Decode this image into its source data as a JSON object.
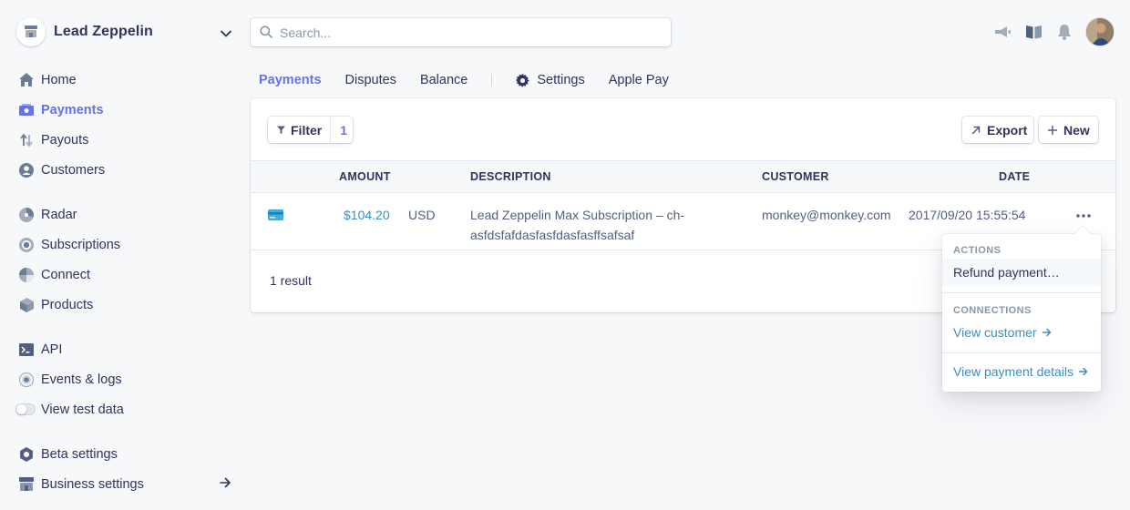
{
  "account": {
    "name": "Lead Zeppelin"
  },
  "search": {
    "placeholder": "Search..."
  },
  "sidebar": {
    "items": [
      {
        "label": "Home",
        "icon": "home-icon"
      },
      {
        "label": "Payments",
        "icon": "payments-icon",
        "active": true
      },
      {
        "label": "Payouts",
        "icon": "payouts-icon"
      },
      {
        "label": "Customers",
        "icon": "customers-icon"
      },
      {
        "label": "Radar",
        "icon": "radar-icon"
      },
      {
        "label": "Subscriptions",
        "icon": "subscriptions-icon"
      },
      {
        "label": "Connect",
        "icon": "connect-icon"
      },
      {
        "label": "Products",
        "icon": "products-icon"
      },
      {
        "label": "API",
        "icon": "terminal-icon"
      },
      {
        "label": "Events & logs",
        "icon": "events-icon"
      },
      {
        "label": "View test data",
        "icon": "toggle"
      },
      {
        "label": "Beta settings",
        "icon": "beta-icon"
      },
      {
        "label": "Business settings",
        "icon": "store-icon"
      }
    ]
  },
  "tabs": [
    {
      "label": "Payments",
      "active": true
    },
    {
      "label": "Disputes"
    },
    {
      "label": "Balance"
    },
    {
      "label": "Settings",
      "icon": "gear-icon"
    },
    {
      "label": "Apple Pay"
    }
  ],
  "toolbar": {
    "filter_label": "Filter",
    "filter_count": "1",
    "export_label": "Export",
    "new_label": "New"
  },
  "table": {
    "columns": [
      "AMOUNT",
      "DESCRIPTION",
      "CUSTOMER",
      "DATE"
    ],
    "rows": [
      {
        "amount": "$104.20",
        "currency": "USD",
        "description_line1": "Lead Zeppelin Max Subscription – ch-",
        "description_line2": "asfdsfafdasfasfdasfasffsafsaf",
        "customer": "monkey@monkey.com",
        "date": "2017/09/20 15:55:54"
      }
    ],
    "result_count": "1 result"
  },
  "menu": {
    "actions_title": "ACTIONS",
    "refund_label": "Refund payment…",
    "connections_title": "CONNECTIONS",
    "view_customer_label": "View customer",
    "view_payment_label": "View payment details"
  },
  "colors": {
    "accent": "#6772e5",
    "link": "#3a8fc3",
    "text": "#32325d",
    "background": "#f6f8fa"
  }
}
